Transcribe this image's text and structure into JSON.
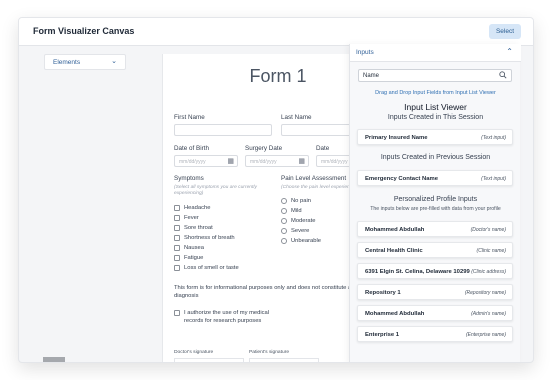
{
  "app": {
    "title": "Form Visualizer Canvas",
    "select_label": "Select"
  },
  "left": {
    "elements_label": "Elements"
  },
  "form": {
    "title": "Form 1",
    "first_name_label": "First Name",
    "last_name_label": "Last Name",
    "dob_label": "Date of Birth",
    "surgery_label": "Surgery Date",
    "date_label": "Date",
    "date_placeholder": "mm/dd/yyyy",
    "symptoms": {
      "label": "Symptoms",
      "hint": "(Select all symptoms you are currently experiencing)",
      "options": [
        "Headache",
        "Fever",
        "Sore throat",
        "Shortness of breath",
        "Nausea",
        "Fatigue",
        "Loss of smell or taste"
      ]
    },
    "pain": {
      "label": "Pain Level Assessment",
      "hint": "(Choose the pain level experienced)",
      "options": [
        "No pain",
        "Mild",
        "Moderate",
        "Severe",
        "Unbearable"
      ]
    },
    "disclaimer": "This form is for informational purposes only and does not constitute a diagnosis",
    "consent": "I authorize the use of my medical records for research purposes",
    "doctor_sig_label": "Doctor's signature",
    "patient_sig_label": "Patient's signature"
  },
  "panel": {
    "header": "Inputs",
    "search_value": "Name",
    "drag_hint": "Drag and Drop Input Fields from Input List Viewer",
    "viewer_title": "Input List Viewer",
    "session_title": "Inputs Created in This Session",
    "session_items": [
      {
        "name": "Primary Insured Name",
        "type": "(Text input)"
      }
    ],
    "previous_title": "Inputs Created in Previous Session",
    "previous_items": [
      {
        "name": "Emergency Contact Name",
        "type": "(Text input)"
      }
    ],
    "profile_title": "Personalized Profile Inputs",
    "profile_hint": "The inputs below are pre-filled with data from your profile",
    "profile_items": [
      {
        "name": "Mohammed Abdullah",
        "type": "(Doctor's name)"
      },
      {
        "name": "Central Health Clinic",
        "type": "(Clinic name)"
      },
      {
        "name": "6391 Elgin St. Celina, Delaware 10299",
        "type": "(Clinic address)"
      },
      {
        "name": "Repository 1",
        "type": "(Repository name)"
      },
      {
        "name": "Mohammed Abdullah",
        "type": "(Admin's name)"
      },
      {
        "name": "Enterprise 1",
        "type": "(Enterprise name)"
      }
    ]
  }
}
